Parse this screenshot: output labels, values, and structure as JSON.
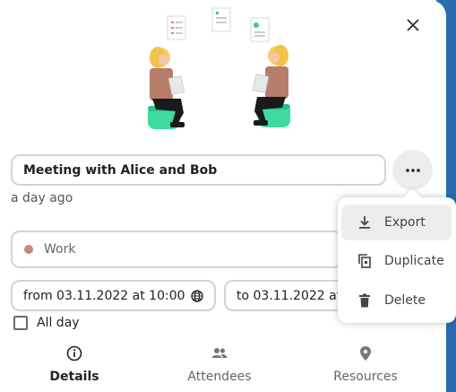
{
  "event": {
    "title": "Meeting with Alice and Bob",
    "modified": "a day ago",
    "calendar": "Work",
    "calendar_color": "#c98879",
    "from": "from 03.11.2022 at 10:00",
    "to": "to 03.11.2022 at",
    "all_day_label": "All day",
    "all_day_checked": false
  },
  "menu": {
    "export": "Export",
    "duplicate": "Duplicate",
    "delete": "Delete"
  },
  "tabs": [
    {
      "label": "Details",
      "icon": "info-icon",
      "active": true
    },
    {
      "label": "Attendees",
      "icon": "people-icon",
      "active": false
    },
    {
      "label": "Resources",
      "icon": "location-pin-icon",
      "active": false
    }
  ],
  "icons": {
    "close": "close-icon",
    "more": "more-icon",
    "timezone": "globe-icon",
    "export": "download-icon",
    "duplicate": "duplicate-icon",
    "delete": "trash-icon"
  },
  "colors": {
    "accent_edge": "#2b6cb0",
    "border": "#d4d4d4",
    "menu_hover": "#ededed"
  }
}
